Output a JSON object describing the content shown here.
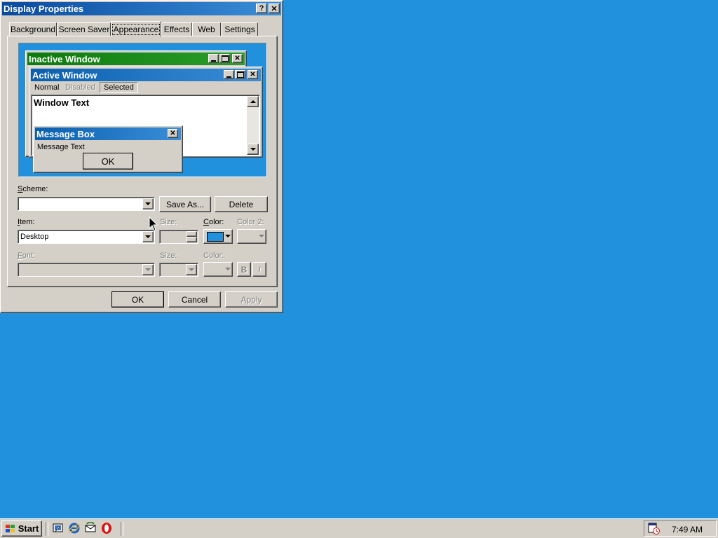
{
  "window": {
    "title": "Display Properties",
    "help_glyph": "?",
    "close_glyph": "✕"
  },
  "tabs": [
    "Background",
    "Screen Saver",
    "Appearance",
    "Effects",
    "Web",
    "Settings"
  ],
  "selected_tab": "Appearance",
  "preview": {
    "inactive_title": "Inactive Window",
    "active_title": "Active Window",
    "menu_normal": "Normal",
    "menu_disabled": "Disabled",
    "menu_selected": "Selected",
    "window_text": "Window Text",
    "msgbox_title": "Message Box",
    "msgbox_text": "Message Text",
    "msgbox_ok": "OK"
  },
  "scheme": {
    "label": "Scheme:",
    "value": "",
    "save_as": "Save As...",
    "delete": "Delete"
  },
  "item": {
    "label": "Item:",
    "value": "Desktop",
    "size_label": "Size:",
    "color_label": "Color:",
    "color2_label": "Color 2:",
    "color_value": "#2191dd"
  },
  "font": {
    "label": "Font:",
    "size_label": "Size:",
    "color_label": "Color:",
    "bold": "B",
    "italic": "I"
  },
  "buttons": {
    "ok": "OK",
    "cancel": "Cancel",
    "apply": "Apply"
  },
  "taskbar": {
    "start": "Start",
    "time": "7:49 AM"
  },
  "colors": {
    "desktop": "#2191dd",
    "active_title": "#0a6ab8",
    "inactive_title": "#1c8a1c",
    "face": "#d4d0c8"
  }
}
